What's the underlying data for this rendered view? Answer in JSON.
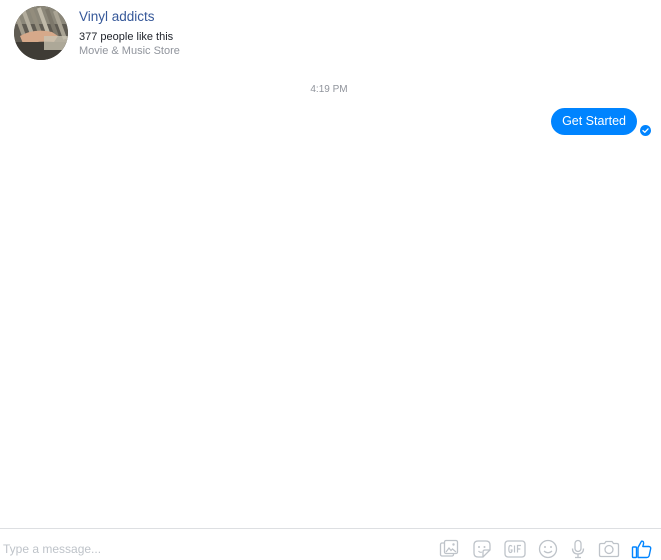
{
  "page": {
    "name": "Vinyl addicts",
    "likes_text": "377 people like this",
    "category": "Movie & Music Store"
  },
  "conversation": {
    "timestamp": "4:19 PM",
    "messages": [
      {
        "text": "Get Started",
        "from": "user",
        "status": "sent"
      }
    ]
  },
  "composer": {
    "placeholder": "Type a message...",
    "value": "",
    "tools": [
      "image-icon",
      "sticker-icon",
      "gif-icon",
      "emoji-icon",
      "microphone-icon",
      "camera-icon",
      "like-icon"
    ]
  },
  "colors": {
    "accent": "#0084ff",
    "link": "#365899",
    "muted": "#90949c",
    "icon": "#bec3c9"
  }
}
